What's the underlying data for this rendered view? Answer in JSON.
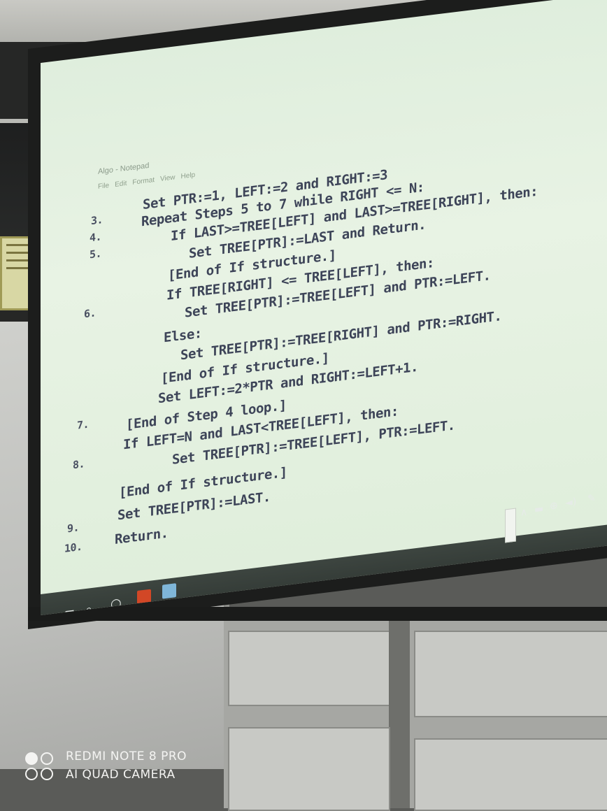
{
  "notepad": {
    "title": "Algo - Notepad",
    "menu": [
      "File",
      "Edit",
      "Format",
      "View",
      "Help"
    ]
  },
  "algorithm": {
    "lines": [
      {
        "num": "",
        "text": "Set PTR:=1, LEFT:=2 and RIGHT:=3"
      },
      {
        "num": "3.",
        "text": "Repeat Steps 5 to 7 while RIGHT <= N:"
      },
      {
        "num": "4.",
        "text": "If LAST>=TREE[LEFT] and LAST>=TREE[RIGHT], then:"
      },
      {
        "num": "5.",
        "text": "Set TREE[PTR]:=LAST and Return."
      },
      {
        "num": "",
        "text": "[End of If structure.]"
      },
      {
        "num": "",
        "text": "If TREE[RIGHT] <= TREE[LEFT], then:"
      },
      {
        "num": "6.",
        "text": "Set TREE[PTR]:=TREE[LEFT] and PTR:=LEFT."
      },
      {
        "num": "",
        "text": "Else:"
      },
      {
        "num": "",
        "text": "Set TREE[PTR]:=TREE[RIGHT] and PTR:=RIGHT."
      },
      {
        "num": "",
        "text": "[End of If structure.]"
      },
      {
        "num": "",
        "text": "Set LEFT:=2*PTR and RIGHT:=LEFT+1."
      },
      {
        "num": "7.",
        "text": "[End of Step 4 loop.]"
      },
      {
        "num": "",
        "text": "If LEFT=N and LAST<TREE[LEFT], then:"
      },
      {
        "num": "8.",
        "text": "Set TREE[PTR]:=TREE[LEFT], PTR:=LEFT."
      },
      {
        "num": "",
        "text": "[End of If structure.]"
      },
      {
        "num": "9.",
        "text": "Set TREE[PTR]:=LAST."
      },
      {
        "num": "10.",
        "text": "Return."
      }
    ]
  },
  "taskbar": {
    "start_icon": "windows-start-icon",
    "search_icon": "search-icon",
    "cortana_icon": "cortana-circle-icon",
    "apps": [
      "powerpoint-app-icon",
      "notepad-app-icon"
    ],
    "tray": [
      "chevron-up-icon",
      "battery-icon",
      "globe-icon",
      "speaker-icon",
      "pen-icon"
    ]
  },
  "watermark": {
    "line1": "REDMI NOTE 8 PRO",
    "line2": "AI QUAD CAMERA"
  },
  "colors": {
    "screen": "#e4f1e1",
    "code_text": "#3d4458",
    "taskbar": "#323a35"
  }
}
